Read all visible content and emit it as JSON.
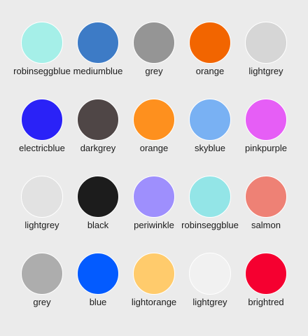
{
  "swatches": [
    {
      "label": "robinseggblue",
      "color": "#a5efe8"
    },
    {
      "label": "mediumblue",
      "color": "#3d7bc6"
    },
    {
      "label": "grey",
      "color": "#959595"
    },
    {
      "label": "orange",
      "color": "#f26500"
    },
    {
      "label": "lightgrey",
      "color": "#d6d6d6"
    },
    {
      "label": "electricblue",
      "color": "#2a22f7"
    },
    {
      "label": "darkgrey",
      "color": "#4f4646"
    },
    {
      "label": "orange",
      "color": "#fe901e"
    },
    {
      "label": "skyblue",
      "color": "#79b1f3"
    },
    {
      "label": "pinkpurple",
      "color": "#e65ef6"
    },
    {
      "label": "lightgrey",
      "color": "#e2e2e2"
    },
    {
      "label": "black",
      "color": "#1c1c1c"
    },
    {
      "label": "periwinkle",
      "color": "#9e8ffd"
    },
    {
      "label": "robinseggblue",
      "color": "#93e5e7"
    },
    {
      "label": "salmon",
      "color": "#ee8175"
    },
    {
      "label": "grey",
      "color": "#adadad"
    },
    {
      "label": "blue",
      "color": "#035bff"
    },
    {
      "label": "lightorange",
      "color": "#ffcb6c"
    },
    {
      "label": "lightgrey",
      "color": "#f1f1f1"
    },
    {
      "label": "brightred",
      "color": "#f50030"
    }
  ]
}
